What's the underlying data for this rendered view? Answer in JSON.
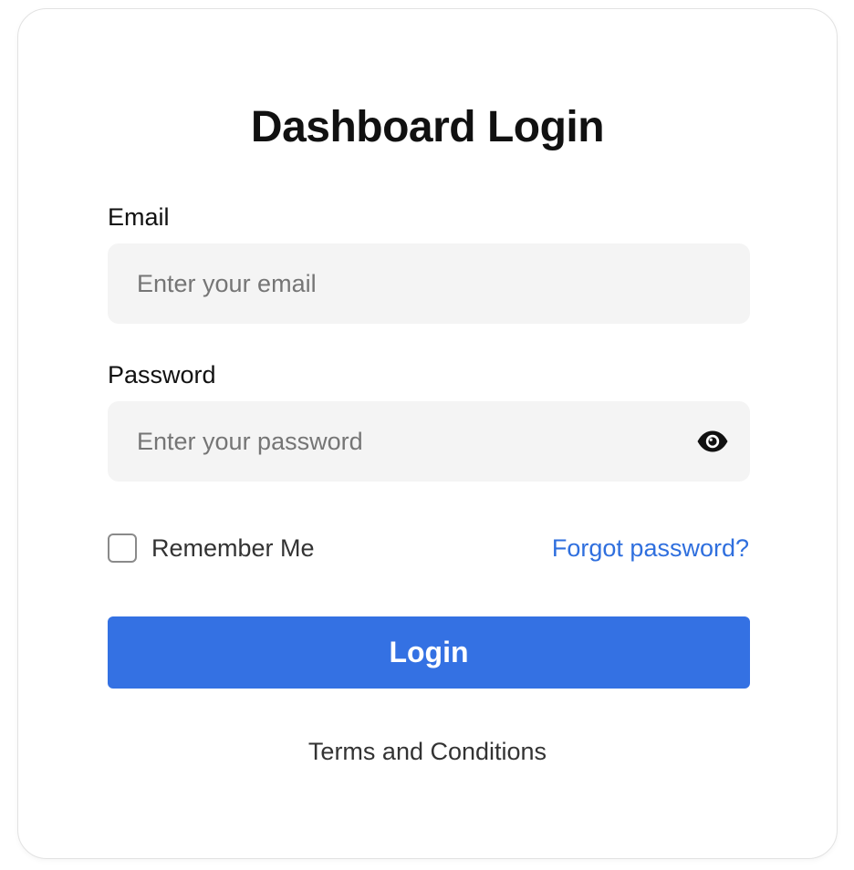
{
  "login_form": {
    "title": "Dashboard Login",
    "email": {
      "label": "Email",
      "value": "",
      "placeholder": "Enter your email"
    },
    "password": {
      "label": "Password",
      "value": "",
      "placeholder": "Enter your password",
      "toggle_icon": "eye-icon"
    },
    "remember_me": {
      "label": "Remember Me",
      "checked": false
    },
    "forgot_password_label": "Forgot password?",
    "login_button_label": "Login",
    "terms_label": "Terms and Conditions"
  },
  "colors": {
    "accent": "#3471e3",
    "link": "#2f6fde",
    "input_background": "#f4f4f4",
    "title_text": "#111111"
  }
}
